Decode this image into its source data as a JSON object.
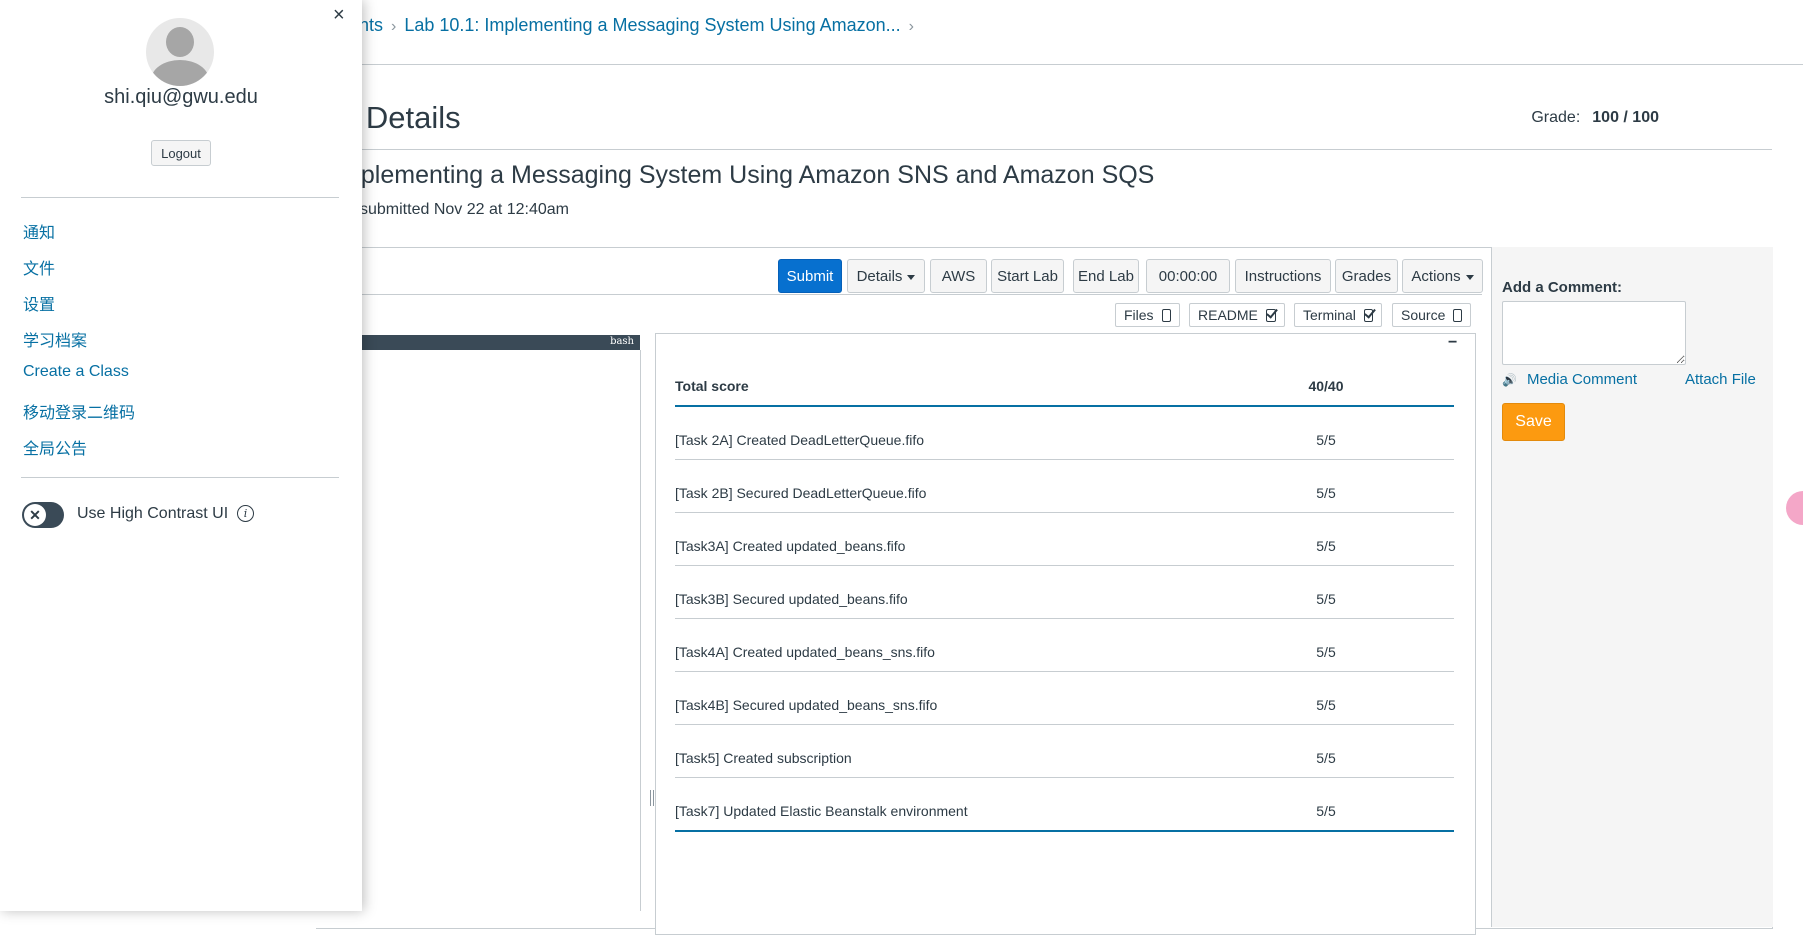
{
  "breadcrumbs": [
    "ents",
    "Lab 10.1: Implementing a Messaging System Using Amazon..."
  ],
  "page_title": "n Details",
  "grade": {
    "label": "Grade:",
    "value": "100 / 100"
  },
  "assignment_title": "nplementing a Messaging System Using Amazon SNS and Amazon SQS",
  "submitted": "submitted Nov 22 at 12:40am",
  "toolbar": {
    "submit": "Submit",
    "details": "Details",
    "aws": "AWS",
    "start_lab": "Start Lab",
    "end_lab": "End Lab",
    "timer": "00:00:00",
    "instructions": "Instructions",
    "grades": "Grades",
    "actions": "Actions"
  },
  "view_toggles": [
    {
      "label": "Files",
      "checked": false
    },
    {
      "label": "README",
      "checked": true
    },
    {
      "label": "Terminal",
      "checked": true
    },
    {
      "label": "Source",
      "checked": false
    }
  ],
  "terminal": {
    "label": "bash"
  },
  "readme": {
    "minimize": "−"
  },
  "score_table": {
    "header": {
      "name": "Total score",
      "value": "40/40"
    },
    "rows": [
      {
        "name": "[Task 2A] Created DeadLetterQueue.fifo",
        "value": "5/5"
      },
      {
        "name": "[Task 2B] Secured DeadLetterQueue.fifo",
        "value": "5/5"
      },
      {
        "name": "[Task3A] Created updated_beans.fifo",
        "value": "5/5"
      },
      {
        "name": "[Task3B] Secured updated_beans.fifo",
        "value": "5/5"
      },
      {
        "name": "[Task4A] Created updated_beans_sns.fifo",
        "value": "5/5"
      },
      {
        "name": "[Task4B] Secured updated_beans_sns.fifo",
        "value": "5/5"
      },
      {
        "name": "[Task5] Created subscription",
        "value": "5/5"
      },
      {
        "name": "[Task7] Updated Elastic Beanstalk environment",
        "value": "5/5"
      }
    ]
  },
  "comments": {
    "heading": "Add a Comment:",
    "media_comment": "Media Comment",
    "attach_file": "Attach File",
    "save": "Save"
  },
  "tray": {
    "close": "×",
    "email": "shi.qiu@gwu.edu",
    "logout": "Logout",
    "links": [
      "通知",
      "文件",
      "设置",
      "学习档案",
      "Create a Class",
      "移动登录二维码",
      "全局公告"
    ],
    "high_contrast_label": "Use High Contrast UI",
    "high_contrast_on": false,
    "toggle_glyph": "✕",
    "info_glyph": "i"
  },
  "colors": {
    "link": "#0770a3",
    "primary_button": "#0770cf",
    "save_button": "#fc9a10",
    "text": "#2d3b45"
  }
}
